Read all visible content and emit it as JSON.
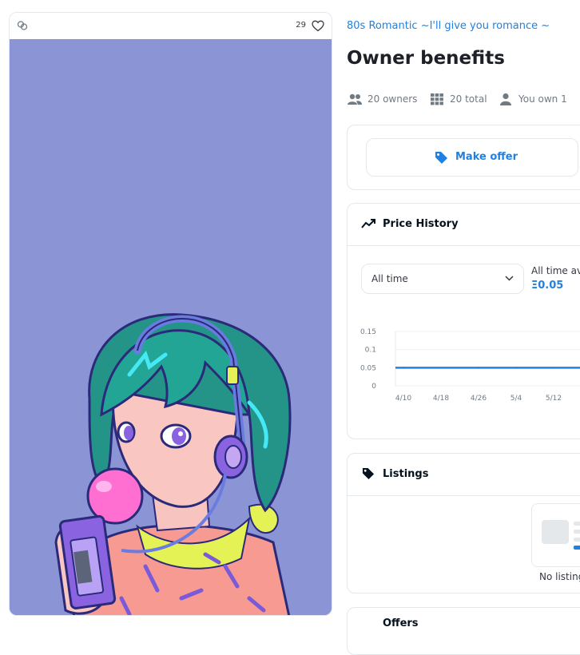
{
  "asset_card": {
    "likes": "29",
    "background_color": "#8b95d6"
  },
  "collection_name": "80s Romantic ~I'll give you romance ~",
  "item_title": "Owner benefits",
  "stats": {
    "owners": "20 owners",
    "total": "20 total",
    "you_own": "You own 1"
  },
  "make_offer_label": "Make offer",
  "price_history": {
    "title": "Price History",
    "period_selected": "All time",
    "average_label": "All time av",
    "average_value": "Ξ0.05"
  },
  "listings": {
    "title": "Listings",
    "empty_text": "No listing"
  },
  "offers": {
    "title": "Offers"
  },
  "chart_data": {
    "type": "line",
    "categories": [
      "4/10",
      "4/18",
      "4/26",
      "5/4",
      "5/12"
    ],
    "y_tick_labels": [
      "0.15",
      "0.1",
      "0.05",
      "0"
    ],
    "ylim": [
      0,
      0.15
    ],
    "series": [
      {
        "values": [
          0.05,
          0.05,
          0.05,
          0.05,
          0.05
        ]
      }
    ],
    "grid": true,
    "line_color": "#2081e2"
  },
  "colors": {
    "accent": "#2081e2",
    "title_text": "#1d2127",
    "muted_text": "#707a83"
  }
}
